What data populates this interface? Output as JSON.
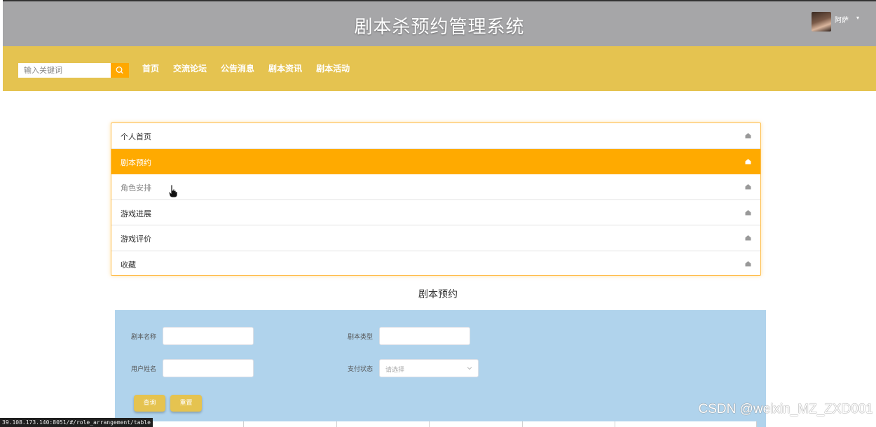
{
  "header": {
    "title": "剧本杀预约管理系统",
    "user": {
      "name": "阿萨",
      "caret": "▾"
    }
  },
  "navbar": {
    "search_placeholder": "输入关键词",
    "links": [
      "首页",
      "交流论坛",
      "公告消息",
      "剧本资讯",
      "剧本活动"
    ]
  },
  "menu": {
    "items": [
      "个人首页",
      "剧本预约",
      "角色安排",
      "游戏进展",
      "游戏评价",
      "收藏"
    ],
    "active_index": 1,
    "icon": "home-icon"
  },
  "section": {
    "title": "剧本预约"
  },
  "filters": {
    "name_label": "剧本名称",
    "type_label": "剧本类型",
    "user_label": "用户姓名",
    "pay_label": "支付状态",
    "pay_placeholder": "请选择",
    "query_button": "查询",
    "reset_button": "重置"
  },
  "status_bar": {
    "url": "39.108.173.140:8051/#/role_arrangement/table"
  },
  "watermark": "CSDN @weixin_MZ_ZXD001",
  "colors": {
    "header_bg": "#a6a6a8",
    "nav_bg": "#e5c350",
    "accent": "#ffaa00",
    "panel_bg": "#b0d3ec"
  }
}
